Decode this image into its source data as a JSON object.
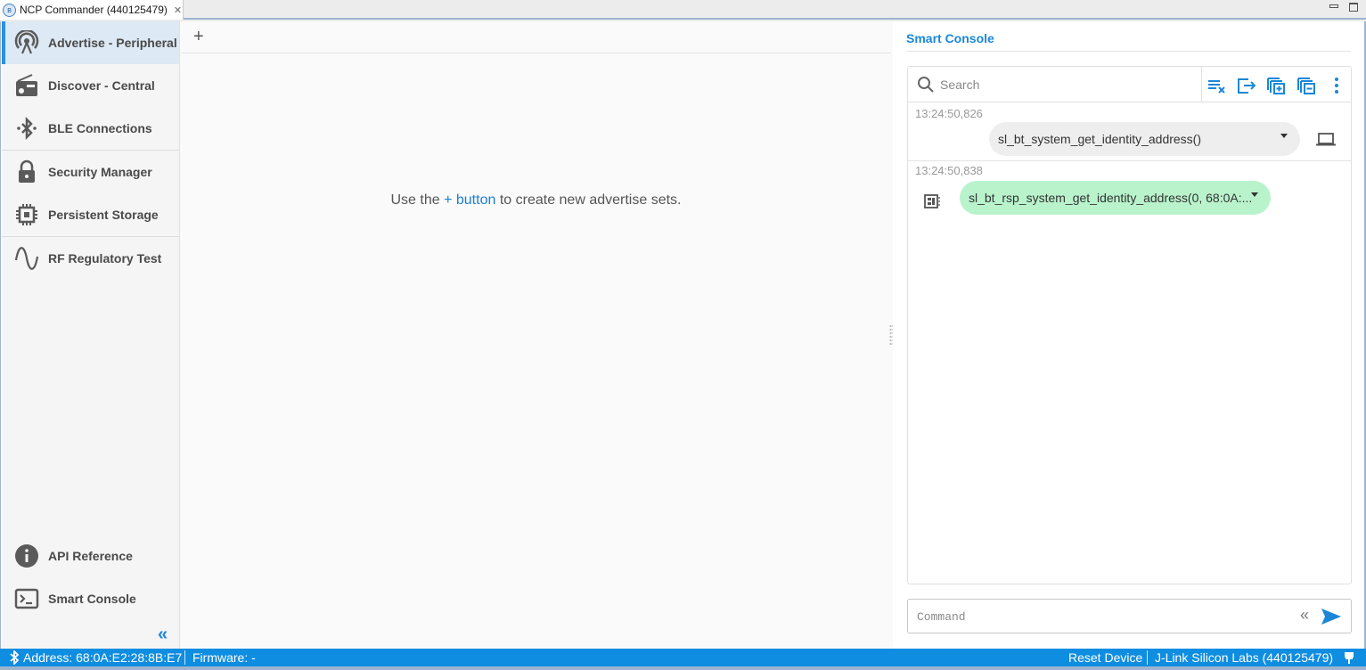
{
  "window": {
    "tab_title": "NCP Commander (440125479)",
    "tab_close": "✕"
  },
  "sidebar": {
    "items": [
      {
        "label": "Advertise - Peripheral",
        "icon": "antenna-icon",
        "active": true
      },
      {
        "label": "Discover - Central",
        "icon": "radio-icon"
      },
      {
        "label": "BLE Connections",
        "icon": "bluetooth-icon"
      },
      {
        "label": "Security Manager",
        "icon": "lock-icon"
      },
      {
        "label": "Persistent Storage",
        "icon": "chip-icon"
      },
      {
        "label": "RF Regulatory Test",
        "icon": "sine-wave-icon"
      }
    ],
    "bottom_items": [
      {
        "label": "API Reference",
        "icon": "info-icon"
      },
      {
        "label": "Smart Console",
        "icon": "terminal-icon"
      }
    ],
    "collapse_label": "«"
  },
  "main": {
    "add_label": "+",
    "empty_prefix": "Use the",
    "empty_link": "+ button",
    "empty_suffix": "to create new advertise sets."
  },
  "console": {
    "title": "Smart Console",
    "search_placeholder": "Search",
    "toolbar": [
      "clear-log-icon",
      "export-icon",
      "expand-all-icon",
      "collapse-all-icon",
      "more-vert-icon"
    ],
    "entries": [
      {
        "timestamp": "13:24:50,826",
        "text": "sl_bt_system_get_identity_address()",
        "kind": "command",
        "source_icon": "laptop-icon"
      },
      {
        "timestamp": "13:24:50,838",
        "text": "sl_bt_rsp_system_get_identity_address(0, 68:0A:...",
        "kind": "response",
        "source_icon": "device-chip-icon"
      }
    ],
    "command_placeholder": "Command",
    "history_label": "«"
  },
  "statusbar": {
    "address": "Address: 68:0A:E2:28:8B:E7",
    "firmware": "Firmware: -",
    "reset": "Reset Device",
    "adapter": "J-Link Silicon Labs (440125479)"
  },
  "colors": {
    "accent": "#1a87d9",
    "statusbar": "#0f8de0",
    "command_bubble": "#eeeeee",
    "response_bubble": "#b9f3cc",
    "active_nav": "#dde9f4"
  }
}
